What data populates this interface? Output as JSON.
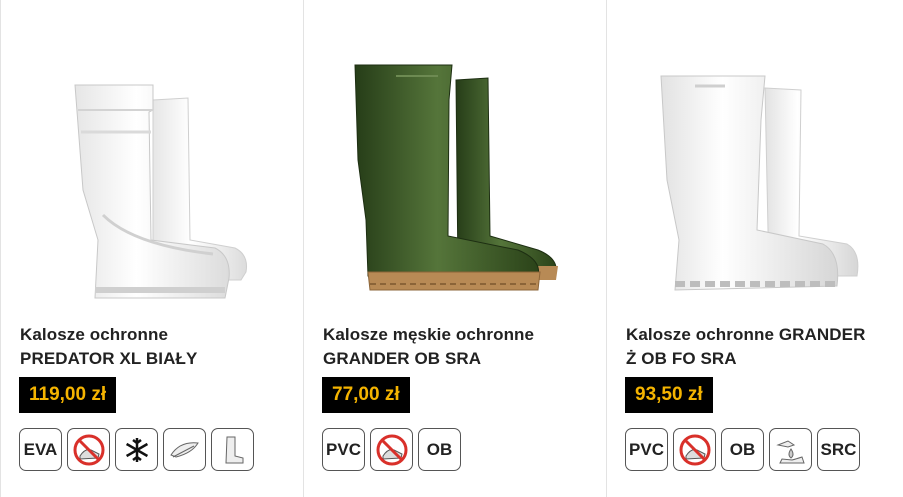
{
  "products": [
    {
      "title_line1": "Kalosze ochronne",
      "title_line2": "PREDATOR XL BIAŁY",
      "price": "119,00 zł",
      "badges": [
        "EVA",
        "no-slip-icon",
        "snowflake-icon",
        "feather-icon",
        "boot-icon"
      ]
    },
    {
      "title_line1": "Kalosze męskie ochronne",
      "title_line2": "GRANDER OB SRA",
      "price": "77,00 zł",
      "badges": [
        "PVC",
        "no-slip-icon",
        "OB"
      ]
    },
    {
      "title_line1": "Kalosze ochronne GRANDER",
      "title_line2": "Ż OB FO SRA",
      "price": "93,50 zł",
      "badges": [
        "PVC",
        "no-slip-icon",
        "OB",
        "oil-drop-icon",
        "SRC"
      ]
    }
  ],
  "colors": {
    "price_bg": "#000000",
    "price_text": "#f5b400",
    "boot_white": "#f4f4f4",
    "boot_green": "#3e5a2c",
    "sole_tan": "#b88a55",
    "prohibit_red": "#d9302a"
  }
}
